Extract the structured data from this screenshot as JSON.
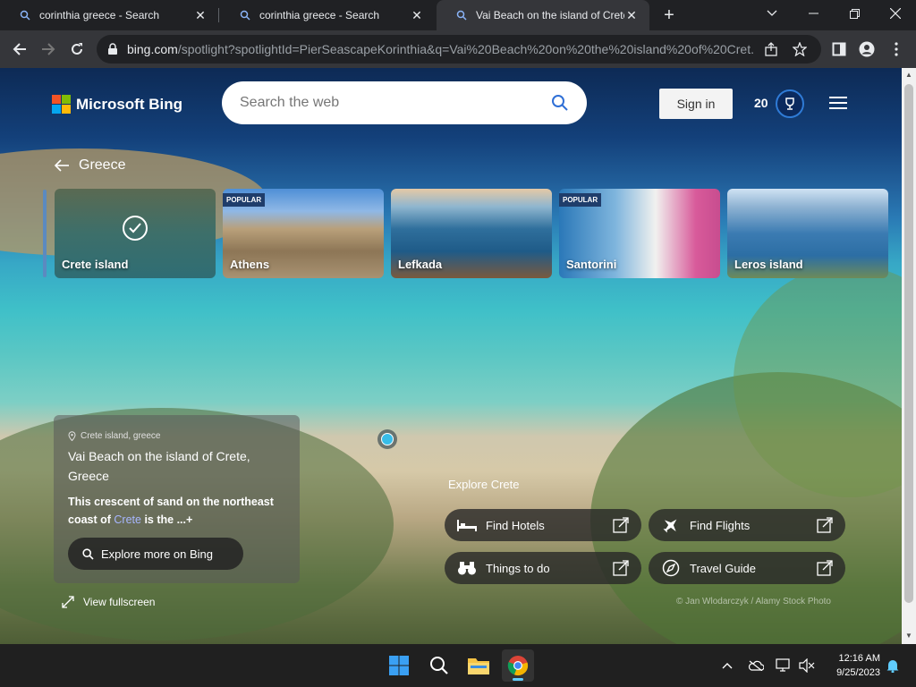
{
  "browser": {
    "tabs": [
      {
        "title": "corinthia greece - Search",
        "active": false
      },
      {
        "title": "corinthia greece - Search",
        "active": false
      },
      {
        "title": "Vai Beach on the island of Crete,",
        "active": true
      }
    ],
    "url_domain": "bing.com",
    "url_path": "/spotlight?spotlightId=PierSeascapeKorinthia&q=Vai%20Beach%20on%20the%20island%20of%20Cret..."
  },
  "header": {
    "logo_text": "Microsoft Bing",
    "search_placeholder": "Search the web",
    "signin_label": "Sign in",
    "points": "20"
  },
  "breadcrumb": {
    "label": "Greece"
  },
  "carousel": [
    {
      "label": "Crete island",
      "badge": "",
      "selected": true
    },
    {
      "label": "Athens",
      "badge": "POPULAR",
      "selected": false
    },
    {
      "label": "Lefkada",
      "badge": "",
      "selected": false
    },
    {
      "label": "Santorini",
      "badge": "POPULAR",
      "selected": false
    },
    {
      "label": "Leros island",
      "badge": "",
      "selected": false
    }
  ],
  "info": {
    "location": "Crete island, greece",
    "title": "Vai Beach on the island of Crete, Greece",
    "desc_before": "This crescent of sand on the northeast coast of ",
    "desc_link": "Crete",
    "desc_after": " is the ...",
    "more": "+",
    "explore_button": "Explore more on Bing"
  },
  "view_fullscreen": "View fullscreen",
  "explore": {
    "title": "Explore Crete",
    "actions": [
      {
        "label": "Find Hotels",
        "icon": "bed-icon"
      },
      {
        "label": "Find Flights",
        "icon": "plane-icon"
      },
      {
        "label": "Things to do",
        "icon": "binoculars-icon"
      },
      {
        "label": "Travel Guide",
        "icon": "compass-icon"
      }
    ]
  },
  "credit": "© Jan Wlodarczyk / Alamy Stock Photo",
  "taskbar": {
    "time": "12:16 AM",
    "date": "9/25/2023"
  },
  "colors": {
    "accent": "#2f7bd6",
    "link_highlight": "#a7b6ff",
    "hotspot": "#38bde8"
  }
}
